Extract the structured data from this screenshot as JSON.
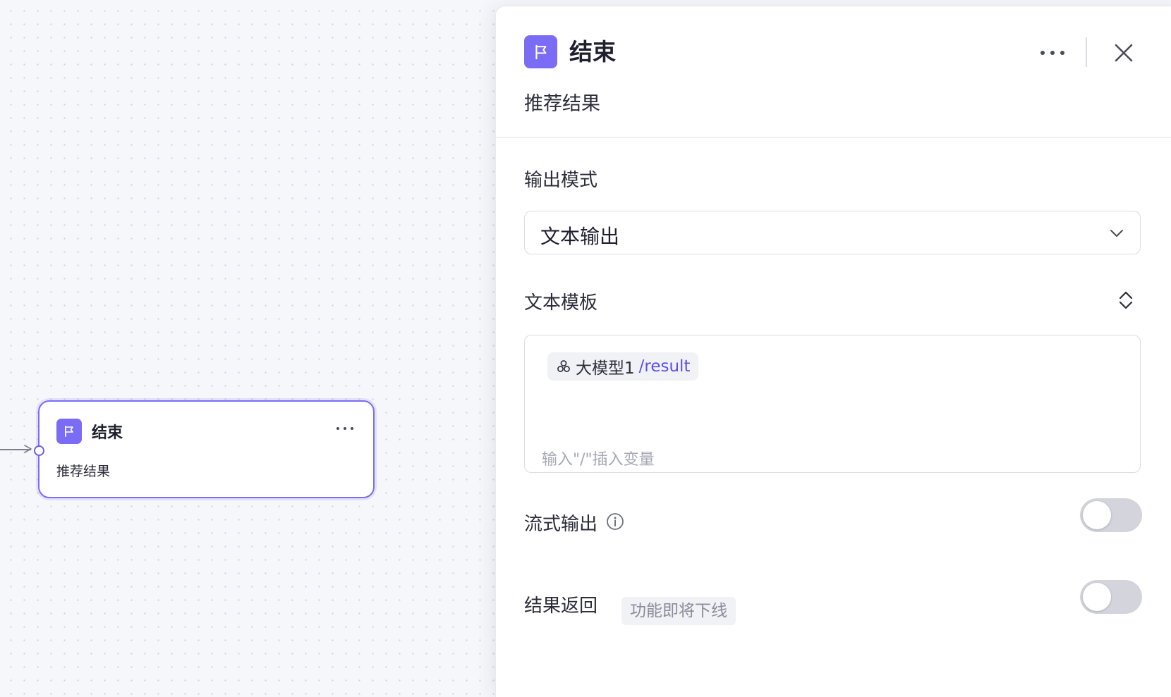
{
  "canvas": {
    "node": {
      "title": "结束",
      "subtitle": "推荐结果",
      "icon": "flag-icon",
      "accent_color": "#7b6cf6"
    }
  },
  "panel": {
    "header": {
      "icon": "flag-icon",
      "title": "结束",
      "subtitle": "推荐结果"
    },
    "output_mode": {
      "label": "输出模式",
      "selected": "文本输出"
    },
    "text_template": {
      "label": "文本模板",
      "variable": {
        "icon": "model-icon",
        "node": "大模型1",
        "path": "/result"
      },
      "placeholder": "输入\"/\"插入变量"
    },
    "streaming": {
      "label": "流式输出",
      "icon": "info-icon",
      "enabled": false
    },
    "result_return": {
      "label": "结果返回",
      "badge": "功能即将下线",
      "enabled": false
    }
  },
  "colors": {
    "accent": "#7b6cf6",
    "variable_path": "#5b4ef0",
    "toggle_off": "#d3d4dc"
  }
}
